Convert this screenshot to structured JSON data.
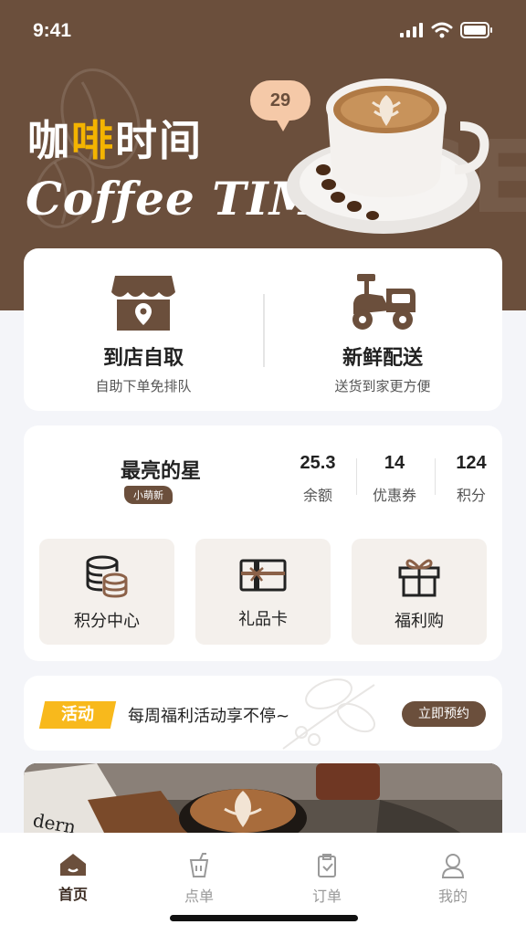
{
  "status_bar": {
    "time": "9:41"
  },
  "hero": {
    "title_cn_part1": "咖",
    "title_cn_highlight": "啡",
    "title_cn_part2": "时间",
    "title_en": "Coffee TIME",
    "bubble_number": "29",
    "bg_letters": "CE"
  },
  "services": [
    {
      "title": "到店自取",
      "subtitle": "自助下单免排队",
      "icon": "shop-icon"
    },
    {
      "title": "新鲜配送",
      "subtitle": "送货到家更方便",
      "icon": "scooter-icon"
    }
  ],
  "member": {
    "name": "最亮的星",
    "badge": "小萌新",
    "stats": [
      {
        "value": "25.3",
        "label": "余额"
      },
      {
        "value": "14",
        "label": "优惠券"
      },
      {
        "value": "124",
        "label": "积分"
      }
    ],
    "tiles": [
      {
        "label": "积分中心",
        "icon": "coins-icon"
      },
      {
        "label": "礼品卡",
        "icon": "gift-card-icon"
      },
      {
        "label": "福利购",
        "icon": "gift-box-icon"
      }
    ]
  },
  "activity": {
    "tag": "活动",
    "text": "每周福利活动享不停~",
    "button": "立即预约"
  },
  "banner": {
    "text": "dern"
  },
  "tabbar": [
    {
      "label": "首页",
      "icon": "home-icon",
      "active": true
    },
    {
      "label": "点单",
      "icon": "drink-icon",
      "active": false
    },
    {
      "label": "订单",
      "icon": "order-icon",
      "active": false
    },
    {
      "label": "我的",
      "icon": "user-icon",
      "active": false
    }
  ],
  "colors": {
    "brand_brown": "#6b4f3c",
    "accent_yellow": "#f8b91c",
    "bubble_peach": "#f5c9a8"
  }
}
